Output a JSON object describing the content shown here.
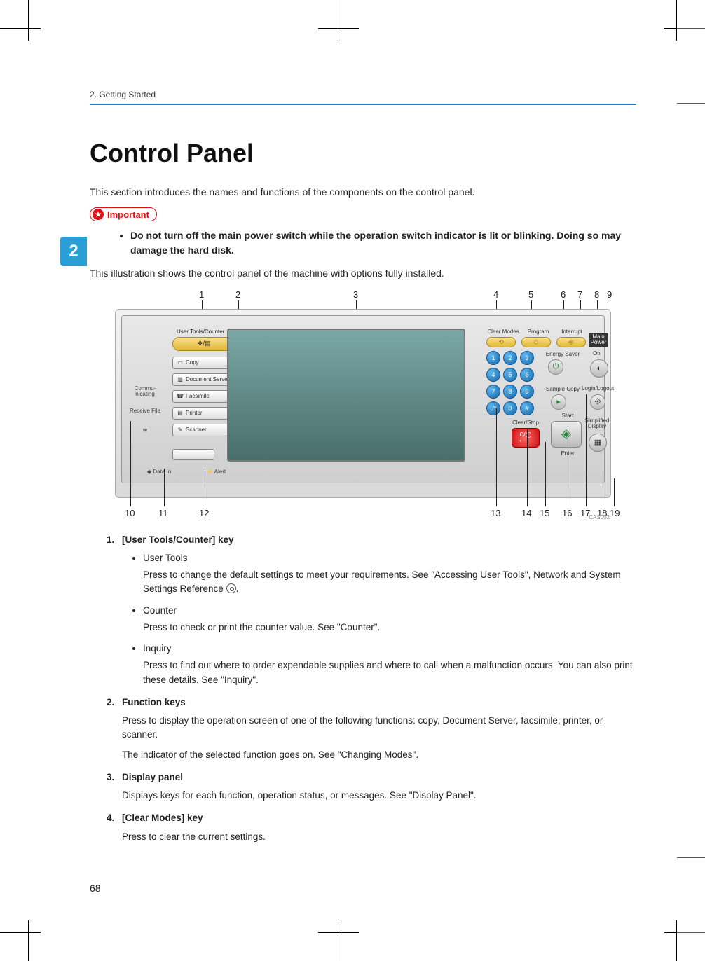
{
  "header": {
    "chapter": "2. Getting Started"
  },
  "tab": "2",
  "title": "Control Panel",
  "intro": "This section introduces the names and functions of the components on the control panel.",
  "important_label": "Important",
  "warning_bullet": "Do not turn off the main power switch while the operation switch indicator is lit or blinking. Doing so may damage the hard disk.",
  "illustration_caption": "This illustration shows the control panel of the machine with options fully installed.",
  "figure": {
    "top_callouts": [
      "1",
      "2",
      "3",
      "4",
      "5",
      "6",
      "7",
      "8",
      "9"
    ],
    "bottom_callouts": [
      "10",
      "11",
      "12",
      "13",
      "14",
      "15",
      "16",
      "17",
      "18",
      "19"
    ],
    "code": "CAS002",
    "labels": {
      "user_tools": "User Tools/Counter",
      "copy": "Copy",
      "doc_server": "Document Server",
      "facsimile": "Facsimile",
      "printer": "Printer",
      "scanner": "Scanner",
      "communicating": "Commu-\nnicating",
      "receive_file": "Receive File",
      "data_in": "Data In",
      "alert": "Alert",
      "clear_modes": "Clear Modes",
      "program": "Program",
      "interrupt": "Interrupt",
      "energy_saver": "Energy Saver",
      "sample_copy": "Sample Copy",
      "start": "Start",
      "enter": "Enter",
      "clear_stop": "Clear/Stop",
      "main_power": "Main\nPower",
      "on": "On",
      "login": "Login/Logout",
      "simplified": "Simplified\nDisplay",
      "keypad": [
        "1",
        "2",
        "3",
        "4",
        "5",
        "6",
        "7",
        "8",
        "9",
        "./*",
        "0",
        "#"
      ]
    }
  },
  "defs": [
    {
      "title": "[User Tools/Counter] key",
      "subs": [
        {
          "name": "User Tools",
          "text_a": "Press to change the default settings to meet your requirements. See \"Accessing User Tools\", Network and System Settings Reference",
          "text_b": ".",
          "cd": true
        },
        {
          "name": "Counter",
          "text_a": "Press to check or print the counter value. See \"Counter\"."
        },
        {
          "name": "Inquiry",
          "text_a": "Press to find out where to order expendable supplies and where to call when a malfunction occurs. You can also print these details. See \"Inquiry\"."
        }
      ]
    },
    {
      "title": "Function keys",
      "body": [
        "Press to display the operation screen of one of the following functions: copy, Document Server, facsimile, printer, or scanner.",
        "The indicator of the selected function goes on. See \"Changing Modes\"."
      ]
    },
    {
      "title": "Display panel",
      "body": [
        "Displays keys for each function, operation status, or messages. See \"Display Panel\"."
      ]
    },
    {
      "title": "[Clear Modes] key",
      "body": [
        "Press to clear the current settings."
      ]
    }
  ],
  "page_number": "68"
}
